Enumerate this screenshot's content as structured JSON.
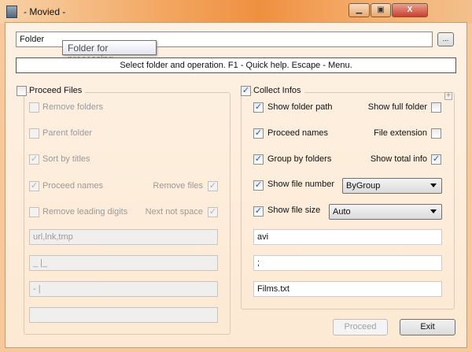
{
  "window": {
    "title": "- Movied -",
    "minimize": "▁",
    "maximize": "▣",
    "close": "X"
  },
  "folder": {
    "value": "Folder",
    "browse_label": "...",
    "tooltip": "Folder for processing"
  },
  "status": "Select folder and operation. F1 - Quick help. Escape - Menu.",
  "proceed_files": {
    "label": "Proceed Files",
    "checked": false,
    "remove_folders": "Remove folders",
    "parent_folder": "Parent folder",
    "sort_by_titles": "Sort by titles",
    "proceed_names": "Proceed names",
    "remove_files": "Remove files",
    "remove_leading_digits": "Remove leading digits",
    "next_not_space": "Next not space",
    "field1": "url,lnk,tmp",
    "field2": "_ |_",
    "field3": "- |",
    "field4": ""
  },
  "collect_infos": {
    "label": "Collect Infos",
    "checked": true,
    "show_folder_path": "Show folder path",
    "show_full_folder": "Show full folder",
    "proceed_names": "Proceed names",
    "file_extension": "File extension",
    "group_by_folders": "Group by folders",
    "show_total_info": "Show total info",
    "show_file_number": "Show file number",
    "file_number_mode": "ByGroup",
    "show_file_size": "Show file size",
    "file_size_mode": "Auto",
    "extensions": "avi",
    "separator": ";",
    "output_file": "Films.txt"
  },
  "buttons": {
    "proceed": "Proceed",
    "exit": "Exit"
  },
  "check": "✓"
}
